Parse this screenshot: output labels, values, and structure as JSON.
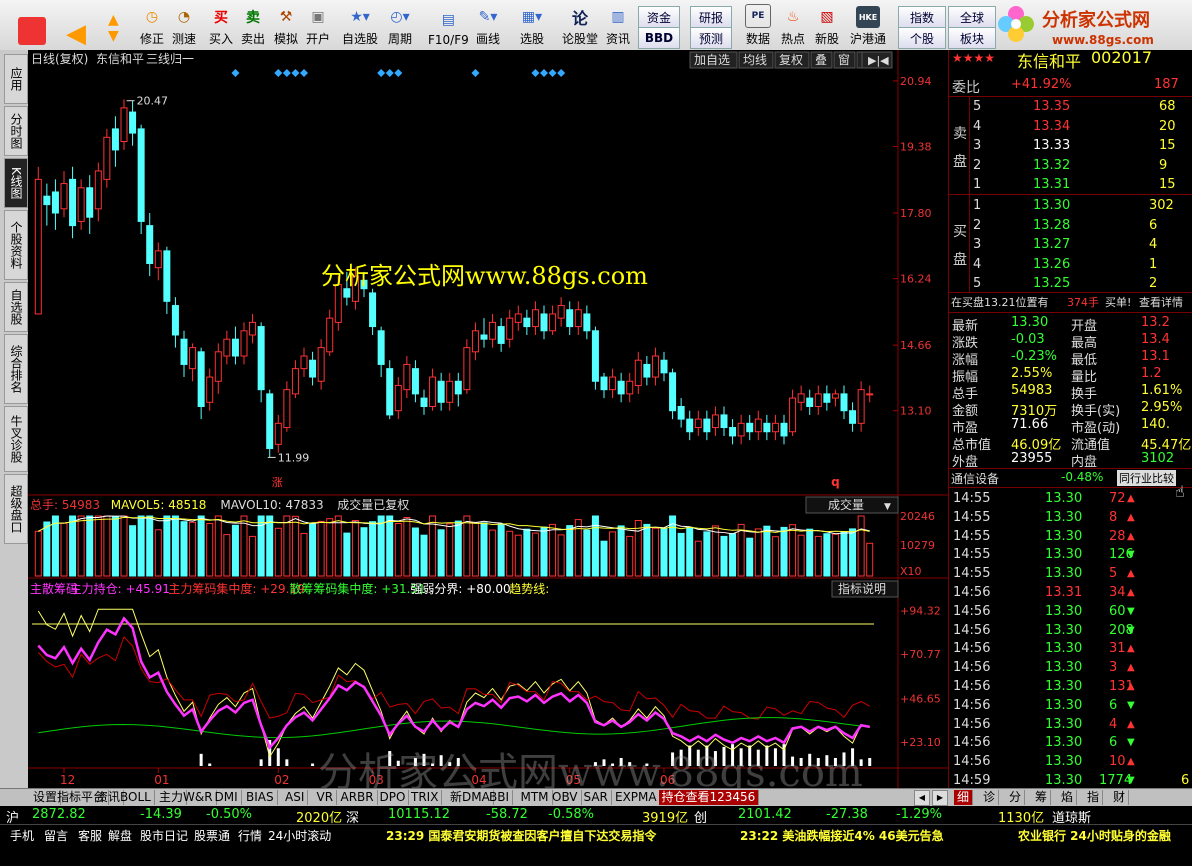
{
  "toolbar": {
    "buttons": [
      "买入",
      "卖出",
      "模拟",
      "开户",
      "自选股",
      "周期",
      "F10/F9",
      "画线",
      "选股",
      "论股堂",
      "资讯",
      "数据",
      "热点",
      "新股",
      "沪港通"
    ],
    "nav_labels": [
      "修正",
      "测速"
    ],
    "small_buttons": [
      "资金",
      "BBD",
      "研报",
      "预测",
      "指数",
      "个股",
      "全球",
      "板块"
    ],
    "hk_badge": "HKE",
    "logo_text": "分析家公式网",
    "logo_url": "www.88gs.com"
  },
  "left_tabs": [
    "应用",
    "分时图",
    "K线图",
    "个股资料",
    "自选股",
    "综合排名",
    "牛叉诊股",
    "超级盘口"
  ],
  "chart_header": {
    "label": "日线(复权)",
    "stock": "东信和平",
    "mode": "三线归一",
    "tools": [
      "加自选",
      "均线",
      "复权",
      "叠",
      "窗",
      "预测"
    ]
  },
  "chart_data": {
    "type": "candlestick",
    "price_axis": [
      "20.94",
      "19.38",
      "17.80",
      "16.24",
      "14.66",
      "13.10"
    ],
    "price_range": [
      11.5,
      21.2
    ],
    "high_label": "20.47",
    "low_label": "11.99",
    "x_labels": [
      "12",
      "01",
      "02",
      "03",
      "04",
      "05",
      "06"
    ],
    "zhang_mark": "涨",
    "q_mark": "q",
    "candles": [
      [
        15.4,
        18.6,
        18.0,
        18.9
      ],
      [
        18.2,
        18.0,
        17.5,
        18.5
      ],
      [
        18.3,
        17.8,
        17.4,
        18.6
      ],
      [
        17.9,
        18.5,
        17.7,
        18.8
      ],
      [
        18.6,
        17.5,
        17.2,
        18.9
      ],
      [
        17.6,
        18.4,
        17.4,
        18.6
      ],
      [
        18.4,
        17.7,
        17.3,
        18.7
      ],
      [
        17.9,
        18.8,
        17.6,
        19.0
      ],
      [
        18.6,
        19.6,
        18.4,
        19.8
      ],
      [
        19.8,
        19.3,
        18.9,
        20.1
      ],
      [
        19.5,
        20.3,
        19.3,
        20.5
      ],
      [
        20.2,
        19.7,
        19.4,
        20.47
      ],
      [
        19.8,
        17.6,
        17.3,
        19.9
      ],
      [
        17.5,
        16.6,
        16.3,
        17.8
      ],
      [
        16.5,
        16.9,
        16.2,
        17.1
      ],
      [
        16.9,
        15.7,
        15.4,
        17.0
      ],
      [
        15.6,
        14.9,
        14.6,
        15.8
      ],
      [
        14.8,
        14.2,
        13.9,
        15.0
      ],
      [
        14.1,
        14.6,
        13.8,
        14.7
      ],
      [
        14.5,
        13.2,
        12.9,
        14.6
      ],
      [
        13.3,
        13.9,
        13.1,
        14.1
      ],
      [
        13.8,
        14.5,
        13.5,
        14.7
      ],
      [
        14.4,
        14.8,
        14.2,
        15.0
      ],
      [
        14.8,
        14.4,
        14.2,
        15.1
      ],
      [
        14.4,
        15.0,
        14.2,
        15.2
      ],
      [
        14.9,
        15.2,
        14.7,
        15.4
      ],
      [
        15.1,
        13.6,
        13.3,
        15.2
      ],
      [
        13.5,
        12.2,
        11.99,
        13.6
      ],
      [
        12.3,
        12.8,
        12.1,
        13.0
      ],
      [
        12.7,
        13.6,
        12.6,
        13.8
      ],
      [
        13.5,
        14.1,
        13.4,
        14.3
      ],
      [
        14.1,
        14.4,
        13.9,
        14.6
      ],
      [
        14.3,
        13.9,
        13.7,
        14.5
      ],
      [
        13.8,
        14.6,
        13.6,
        14.8
      ],
      [
        14.5,
        15.3,
        14.4,
        15.5
      ],
      [
        15.2,
        16.1,
        15.0,
        16.3
      ],
      [
        16.0,
        15.8,
        15.6,
        16.4
      ],
      [
        15.7,
        16.3,
        15.5,
        16.5
      ],
      [
        16.2,
        16.0,
        15.8,
        16.4
      ],
      [
        15.9,
        15.1,
        14.9,
        16.0
      ],
      [
        15.0,
        14.2,
        13.9,
        15.1
      ],
      [
        14.1,
        13.0,
        12.9,
        14.3
      ],
      [
        13.1,
        13.7,
        12.9,
        13.9
      ],
      [
        13.6,
        14.2,
        13.4,
        14.4
      ],
      [
        14.1,
        13.5,
        13.3,
        14.3
      ],
      [
        13.4,
        13.2,
        13.0,
        13.6
      ],
      [
        13.2,
        13.9,
        13.1,
        14.1
      ],
      [
        13.8,
        13.3,
        13.1,
        14.0
      ],
      [
        13.3,
        13.8,
        13.1,
        14.0
      ],
      [
        13.8,
        13.5,
        13.2,
        14.0
      ],
      [
        13.6,
        14.6,
        13.5,
        14.8
      ],
      [
        14.5,
        15.0,
        14.3,
        15.2
      ],
      [
        14.9,
        14.8,
        14.6,
        15.3
      ],
      [
        14.8,
        15.2,
        14.6,
        15.4
      ],
      [
        15.1,
        14.7,
        14.5,
        15.3
      ],
      [
        14.8,
        15.3,
        14.6,
        15.5
      ],
      [
        15.2,
        15.4,
        15.0,
        15.6
      ],
      [
        15.3,
        15.1,
        14.9,
        15.5
      ],
      [
        15.1,
        15.5,
        14.9,
        15.7
      ],
      [
        15.4,
        15.0,
        14.8,
        15.6
      ],
      [
        15.0,
        15.4,
        14.9,
        15.6
      ],
      [
        15.3,
        15.6,
        15.1,
        15.8
      ],
      [
        15.5,
        15.1,
        14.9,
        15.7
      ],
      [
        15.1,
        15.5,
        14.9,
        15.7
      ],
      [
        15.4,
        15.0,
        14.8,
        15.6
      ],
      [
        15.0,
        13.8,
        13.6,
        15.1
      ],
      [
        13.9,
        13.6,
        13.4,
        14.0
      ],
      [
        13.6,
        13.9,
        13.4,
        14.1
      ],
      [
        13.8,
        13.5,
        13.3,
        14.0
      ],
      [
        13.5,
        13.8,
        13.3,
        14.0
      ],
      [
        13.7,
        14.3,
        13.5,
        14.5
      ],
      [
        14.2,
        13.9,
        13.7,
        14.4
      ],
      [
        13.9,
        14.4,
        13.7,
        14.6
      ],
      [
        14.3,
        14.0,
        13.8,
        14.5
      ],
      [
        14.0,
        13.1,
        12.9,
        14.1
      ],
      [
        13.2,
        12.9,
        12.7,
        13.4
      ],
      [
        12.9,
        12.6,
        12.4,
        13.1
      ],
      [
        12.7,
        12.9,
        12.5,
        13.1
      ],
      [
        12.9,
        12.6,
        12.4,
        13.1
      ],
      [
        12.7,
        13.0,
        12.5,
        13.2
      ],
      [
        13.0,
        12.7,
        12.5,
        13.2
      ],
      [
        12.7,
        12.5,
        12.3,
        12.9
      ],
      [
        12.5,
        12.8,
        12.3,
        13.0
      ],
      [
        12.8,
        12.6,
        12.4,
        13.0
      ],
      [
        12.6,
        12.9,
        12.4,
        13.1
      ],
      [
        12.8,
        12.6,
        12.4,
        13.0
      ],
      [
        12.6,
        12.8,
        12.4,
        13.0
      ],
      [
        12.8,
        12.5,
        12.3,
        13.0
      ],
      [
        12.6,
        13.4,
        12.5,
        13.6
      ],
      [
        13.3,
        13.5,
        13.1,
        13.7
      ],
      [
        13.4,
        13.2,
        13.0,
        13.6
      ],
      [
        13.2,
        13.5,
        13.0,
        13.7
      ],
      [
        13.5,
        13.3,
        13.1,
        13.7
      ],
      [
        13.4,
        13.5,
        13.2,
        13.6
      ],
      [
        13.5,
        13.1,
        12.9,
        13.7
      ],
      [
        13.1,
        12.8,
        12.6,
        13.3
      ],
      [
        12.8,
        13.6,
        12.6,
        13.8
      ],
      [
        13.5,
        13.5,
        13.3,
        13.7
      ]
    ],
    "diamonds": [
      23,
      28,
      29,
      30,
      31,
      40,
      41,
      42,
      51,
      58,
      59,
      60,
      61
    ]
  },
  "volume": {
    "header": [
      "总手: 54983",
      "MAVOL5: 48518",
      "MAVOL10: 47833",
      "成交量已复权"
    ],
    "dropdown": "成交量",
    "axis": [
      "20246",
      "10279",
      "X10"
    ]
  },
  "indicator": {
    "header": [
      "主散筹码",
      "主力持仓: +45.91",
      "主力筹码集中度: +29.19",
      "散筹筹码集中度: +31.51",
      "强弱分界: +80.00",
      "趋势线:"
    ],
    "button": "指标说明",
    "axis": [
      "+94.32",
      "+70.77",
      "+46.65",
      "+23.10"
    ]
  },
  "quote": {
    "stars": "★★★★",
    "name": "东信和平",
    "code": "002017",
    "weibi_label": "委比",
    "weibi": "+41.92%",
    "weibi_num": "187",
    "sell_label": [
      "卖",
      "盘"
    ],
    "buy_label": [
      "买",
      "盘"
    ],
    "sell": [
      [
        "5",
        "13.35",
        "68"
      ],
      [
        "4",
        "13.34",
        "20"
      ],
      [
        "3",
        "13.33",
        "15"
      ],
      [
        "2",
        "13.32",
        "9"
      ],
      [
        "1",
        "13.31",
        "15"
      ]
    ],
    "buy": [
      [
        "1",
        "13.30",
        "302"
      ],
      [
        "2",
        "13.28",
        "6"
      ],
      [
        "3",
        "13.27",
        "4"
      ],
      [
        "4",
        "13.26",
        "1"
      ],
      [
        "5",
        "13.25",
        "2"
      ]
    ],
    "position_line": "在买盘13.21位置有",
    "position_vol": "374手",
    "position_buy": "买单!",
    "position_detail": "查看详情",
    "stats": [
      [
        "最新",
        "13.30",
        "开盘",
        "13.2"
      ],
      [
        "涨跌",
        "-0.03",
        "最高",
        "13.4"
      ],
      [
        "涨幅",
        "-0.23%",
        "最低",
        "13.1"
      ],
      [
        "振幅",
        "2.55%",
        "量比",
        "1.2"
      ],
      [
        "总手",
        "54983",
        "换手",
        "1.61%"
      ],
      [
        "金额",
        "7310万",
        "换手(实)",
        "2.95%"
      ],
      [
        "市盈",
        "71.66",
        "市盈(动)",
        "140."
      ],
      [
        "总市值",
        "46.09亿",
        "流通值",
        "45.47亿"
      ],
      [
        "外盘",
        "23955",
        "内盘",
        "3102"
      ]
    ],
    "sector": "通信设备",
    "sector_pct": "-0.48%",
    "sector_btn": "同行业比较",
    "ticks": [
      [
        "14:55",
        "13.30",
        "72",
        "up"
      ],
      [
        "14:55",
        "13.30",
        "8",
        "up"
      ],
      [
        "14:55",
        "13.30",
        "28",
        "up"
      ],
      [
        "14:55",
        "13.30",
        "126",
        "down"
      ],
      [
        "14:55",
        "13.30",
        "5",
        "up"
      ],
      [
        "14:56",
        "13.31",
        "34",
        "up"
      ],
      [
        "14:56",
        "13.30",
        "60",
        "down"
      ],
      [
        "14:56",
        "13.30",
        "208",
        "down"
      ],
      [
        "14:56",
        "13.30",
        "31",
        "up"
      ],
      [
        "14:56",
        "13.30",
        "3",
        "up"
      ],
      [
        "14:56",
        "13.30",
        "131",
        "up"
      ],
      [
        "14:56",
        "13.30",
        "6",
        "down"
      ],
      [
        "14:56",
        "13.30",
        "4",
        "up"
      ],
      [
        "14:56",
        "13.30",
        "6",
        "down"
      ],
      [
        "14:56",
        "13.30",
        "10",
        "up"
      ],
      [
        "14:59",
        "13.30",
        "1774",
        "down"
      ]
    ],
    "last_tick_extra": "6"
  },
  "bottom_tabs": [
    "设置",
    "指标平台",
    "资讯",
    "BOLL",
    "主力",
    "W&R",
    "DMI",
    "BIAS",
    "ASI",
    "VR",
    "ARBR",
    "DPO",
    "TRIX",
    "新DMA",
    "BBI",
    "MTM",
    "OBV",
    "SAR",
    "EXPMA",
    "持仓查看123456"
  ],
  "right_tabs": [
    "细",
    "诊",
    "分",
    "筹",
    "焰",
    "指",
    "财"
  ],
  "index_bar": {
    "sh": [
      "沪",
      "2872.82",
      "-14.39",
      "-0.50%",
      "2020亿"
    ],
    "sz": [
      "深",
      "10115.12",
      "-58.72",
      "-0.58%",
      "3919亿"
    ],
    "cy": [
      "创",
      "2101.42",
      "-27.38",
      "-1.29%",
      "1130亿"
    ],
    "dq": "道琼斯"
  },
  "news": {
    "buttons": [
      "手机",
      "留言",
      "客服",
      "解盘",
      "股市日记",
      "股票通",
      "行情",
      "24小时滚动"
    ],
    "items": [
      "23:29 国泰君安期货被查因客户擅自下达交易指令",
      "23:22 美油跌幅接近4% 46美元告急",
      "农业银行 24小时贴身的金融"
    ]
  },
  "watermark": "分析家公式网www.88gs.com",
  "watermark2": "分析家公式网www.88gs.com"
}
